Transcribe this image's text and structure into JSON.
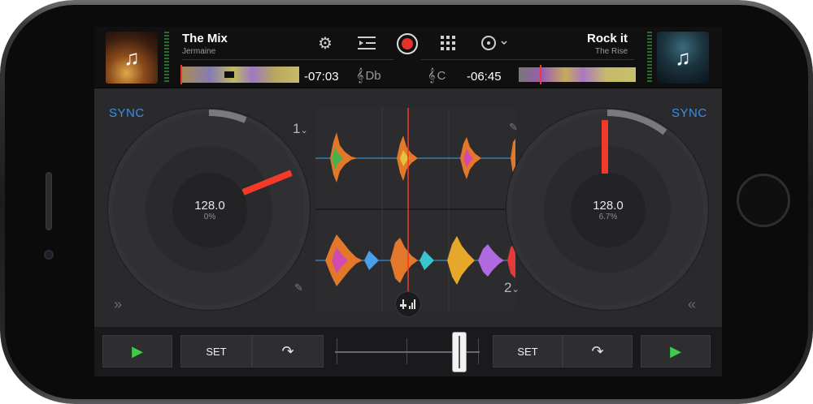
{
  "deck_left": {
    "title": "The Mix",
    "artist": "Jermaine",
    "time_remaining": "-07:03",
    "key": "Db",
    "bpm": "128.0",
    "pitch": "0%",
    "sync_label": "SYNC",
    "deck_number": "1",
    "artwork_icon": "music-note-icon"
  },
  "deck_right": {
    "title": "Rock it",
    "artist": "The Rise",
    "time_remaining": "-06:45",
    "key": "C",
    "bpm": "128.0",
    "pitch": "6.7%",
    "sync_label": "SYNC",
    "deck_number": "2",
    "artwork_icon": "music-note-icon"
  },
  "toolbar": {
    "icons": [
      "gear-icon",
      "playlist-icon",
      "record-icon",
      "grid-icon",
      "disc-menu-icon"
    ]
  },
  "controls_left": {
    "play_icon": "▶",
    "set_label": "SET",
    "loop_icon": "↷"
  },
  "controls_right": {
    "set_label": "SET",
    "loop_icon": "↷",
    "play_icon": "▶"
  },
  "crossfader": {
    "position": 0.87
  },
  "colors": {
    "accent_blue": "#3a8fe6",
    "needle_red": "#f13a2a",
    "record_red": "#e5322b",
    "play_green": "#3ecb48"
  }
}
